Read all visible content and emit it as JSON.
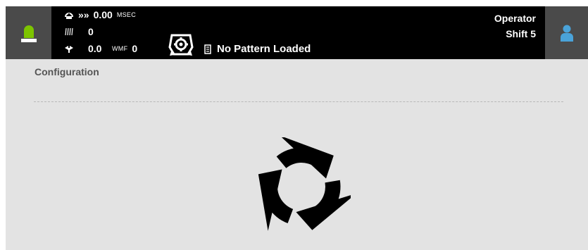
{
  "header": {
    "speed": {
      "icon": "speed-gauge-icon",
      "arrows": "»»",
      "value": "0.00",
      "unit": "MSEC"
    },
    "counter": {
      "icon": "pieces-icon",
      "value": "0"
    },
    "feed": {
      "icon": "feed-icon",
      "value": "0.0",
      "unit": "WMF",
      "unit_value": "0"
    },
    "machine_icon": "machine-settings-icon",
    "pattern": {
      "icon": "pattern-file-icon",
      "label": "No Pattern Loaded"
    },
    "operator": {
      "role": "Operator",
      "shift": "Shift 5",
      "icon": "user-icon"
    },
    "status_light": {
      "icon": "status-light-icon",
      "color": "#7dc400"
    }
  },
  "main": {
    "section_title": "Configuration",
    "loading_icon": "refresh-spinner-icon"
  },
  "colors": {
    "topbar": "#000000",
    "tile": "#4a4a4a",
    "background": "#e3e3e3",
    "user_icon": "#4aa3d9"
  }
}
